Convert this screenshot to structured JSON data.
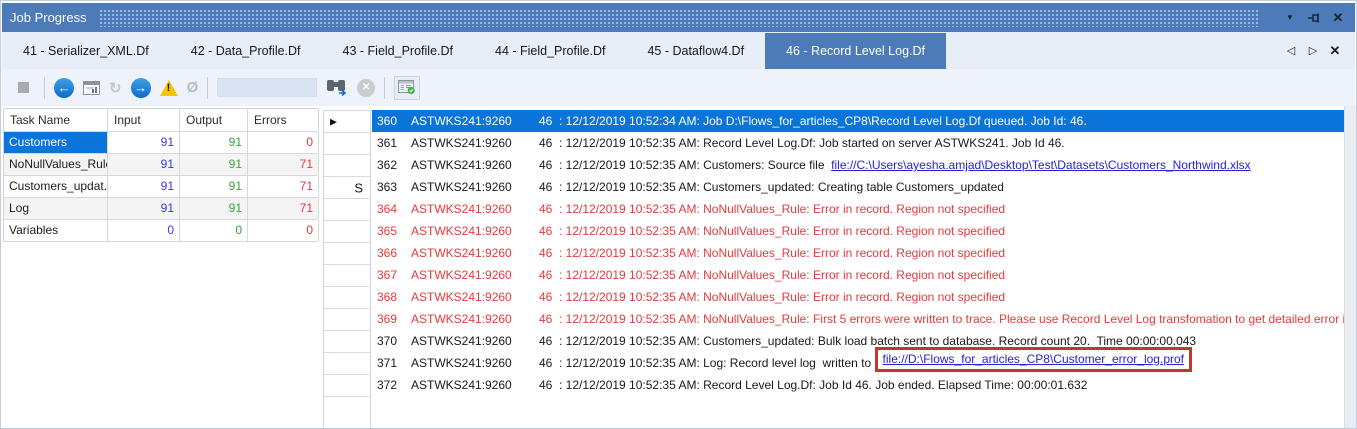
{
  "window": {
    "title": "Job Progress"
  },
  "icons": {
    "menu_arrow": "▼",
    "close": "✕",
    "tab_prev": "◁",
    "tab_next": "▷",
    "tab_close": "✕",
    "back_arrow": "←",
    "forward_arrow": "→",
    "refresh": "↻",
    "null_sign": "Ø",
    "warning_mark": "!",
    "cancel": "✕"
  },
  "tabstrip": {
    "tabs": [
      {
        "label": "41 - Serializer_XML.Df",
        "active": false
      },
      {
        "label": "42 - Data_Profile.Df",
        "active": false
      },
      {
        "label": "43 - Field_Profile.Df",
        "active": false
      },
      {
        "label": "44 - Field_Profile.Df",
        "active": false
      },
      {
        "label": "45 - Dataflow4.Df",
        "active": false
      },
      {
        "label": "46 - Record Level Log.Df",
        "active": true
      }
    ]
  },
  "toolbar": {
    "find_input": {
      "value": "",
      "placeholder": ""
    }
  },
  "task_table": {
    "columns": [
      "Task Name",
      "Input",
      "Output",
      "Errors"
    ],
    "rows": [
      {
        "name": "Customers",
        "input": "91",
        "output": "91",
        "errors": "0",
        "selected": true
      },
      {
        "name": "NoNullValues_Rule",
        "input": "91",
        "output": "91",
        "errors": "71",
        "selected": false
      },
      {
        "name": "Customers_updat...",
        "input": "91",
        "output": "91",
        "errors": "71",
        "selected": false
      },
      {
        "name": "Log",
        "input": "91",
        "output": "91",
        "errors": "71",
        "selected": false
      },
      {
        "name": "Variables",
        "input": "0",
        "output": "0",
        "errors": "0",
        "selected": false
      }
    ]
  },
  "log_grid": {
    "rows": [
      {
        "num": "360",
        "server": "ASTWKS241:9260",
        "job_id": "46",
        "selected": true,
        "error": false,
        "indicator": "▶",
        "message": [
          {
            "text": ": 12/12/2019 10:52:34 AM: Job D:\\Flows_for_articles_CP8\\Record Level Log.Df queued. Job Id: 46."
          }
        ]
      },
      {
        "num": "361",
        "server": "ASTWKS241:9260",
        "job_id": "46",
        "selected": false,
        "error": false,
        "indicator": "",
        "message": [
          {
            "text": ": 12/12/2019 10:52:35 AM: Record Level Log.Df: Job started on server ASTWKS241. Job Id 46."
          }
        ]
      },
      {
        "num": "362",
        "server": "ASTWKS241:9260",
        "job_id": "46",
        "selected": false,
        "error": false,
        "indicator": "",
        "message": [
          {
            "text": ": 12/12/2019 10:52:35 AM: Customers: Source file  "
          },
          {
            "link": "file://C:\\Users\\ayesha.amjad\\Desktop\\Test\\Datasets\\Customers_Northwind.xlsx",
            "boxed": false
          }
        ]
      },
      {
        "num": "363",
        "server": "ASTWKS241:9260",
        "job_id": "46",
        "selected": false,
        "error": false,
        "indicator": "S",
        "message": [
          {
            "text": ": 12/12/2019 10:52:35 AM: Customers_updated: Creating table Customers_updated"
          }
        ]
      },
      {
        "num": "364",
        "server": "ASTWKS241:9260",
        "job_id": "46",
        "selected": false,
        "error": true,
        "indicator": "",
        "message": [
          {
            "text": ": 12/12/2019 10:52:35 AM: NoNullValues_Rule: Error in record. Region not specified"
          }
        ]
      },
      {
        "num": "365",
        "server": "ASTWKS241:9260",
        "job_id": "46",
        "selected": false,
        "error": true,
        "indicator": "",
        "message": [
          {
            "text": ": 12/12/2019 10:52:35 AM: NoNullValues_Rule: Error in record. Region not specified"
          }
        ]
      },
      {
        "num": "366",
        "server": "ASTWKS241:9260",
        "job_id": "46",
        "selected": false,
        "error": true,
        "indicator": "",
        "message": [
          {
            "text": ": 12/12/2019 10:52:35 AM: NoNullValues_Rule: Error in record. Region not specified"
          }
        ]
      },
      {
        "num": "367",
        "server": "ASTWKS241:9260",
        "job_id": "46",
        "selected": false,
        "error": true,
        "indicator": "",
        "message": [
          {
            "text": ": 12/12/2019 10:52:35 AM: NoNullValues_Rule: Error in record. Region not specified"
          }
        ]
      },
      {
        "num": "368",
        "server": "ASTWKS241:9260",
        "job_id": "46",
        "selected": false,
        "error": true,
        "indicator": "",
        "message": [
          {
            "text": ": 12/12/2019 10:52:35 AM: NoNullValues_Rule: Error in record. Region not specified"
          }
        ]
      },
      {
        "num": "369",
        "server": "ASTWKS241:9260",
        "job_id": "46",
        "selected": false,
        "error": true,
        "indicator": "",
        "message": [
          {
            "text": ": 12/12/2019 10:52:35 AM: NoNullValues_Rule: First 5 errors were written to trace. Please use Record Level Log transfomation to get detailed error information for eac"
          }
        ]
      },
      {
        "num": "370",
        "server": "ASTWKS241:9260",
        "job_id": "46",
        "selected": false,
        "error": false,
        "indicator": "",
        "message": [
          {
            "text": ": 12/12/2019 10:52:35 AM: Customers_updated: Bulk load batch sent to database. Record count 20.  Time 00:00:00.043"
          }
        ]
      },
      {
        "num": "371",
        "server": "ASTWKS241:9260",
        "job_id": "46",
        "selected": false,
        "error": false,
        "indicator": "",
        "message": [
          {
            "text": ": 12/12/2019 10:52:35 AM: Log: Record level log  written to "
          },
          {
            "link": "file://D:\\Flows_for_articles_CP8\\Customer_error_log.prof",
            "boxed": true
          }
        ]
      },
      {
        "num": "372",
        "server": "ASTWKS241:9260",
        "job_id": "46",
        "selected": false,
        "error": false,
        "indicator": "",
        "message": [
          {
            "text": ": 12/12/2019 10:52:35 AM: Record Level Log.Df: Job Id 46. Job ended. Elapsed Time: 00:00:01.632"
          }
        ]
      }
    ]
  },
  "colors": {
    "accent_blue": "#4d7ab8",
    "selection_blue": "#0a74da",
    "error_red": "#e23b3d",
    "link_blue": "#2323d9",
    "input_blue": "#3a3ad0",
    "output_green": "#3aa43e",
    "annotation_red": "#c0392b"
  }
}
